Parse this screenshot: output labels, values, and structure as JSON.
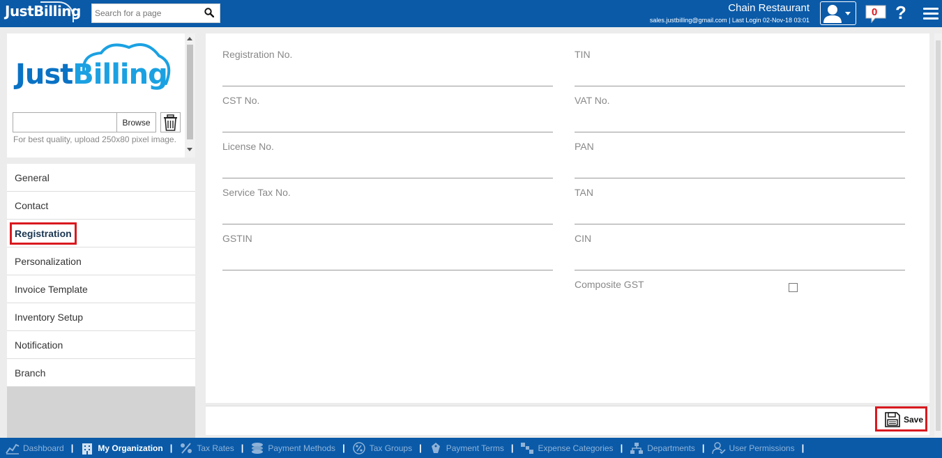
{
  "header": {
    "brand": "JustBilling",
    "search_placeholder": "Search for a page",
    "org_name": "Chain Restaurant",
    "user_line": "sales.justbilling@gmail.com | Last Login 02-Nov-18 03:01",
    "notification_count": "0",
    "help_label": "?"
  },
  "logo_panel": {
    "logo_just": "Just",
    "logo_billing": "Billing",
    "browse_label": "Browse",
    "upload_hint": "For best quality, upload 250x80 pixel image."
  },
  "nav": {
    "items": [
      {
        "label": "General"
      },
      {
        "label": "Contact"
      },
      {
        "label": "Registration",
        "active": true
      },
      {
        "label": "Personalization"
      },
      {
        "label": "Invoice Template"
      },
      {
        "label": "Inventory Setup"
      },
      {
        "label": "Notification"
      },
      {
        "label": "Branch"
      }
    ]
  },
  "form": {
    "fields": [
      {
        "label": "Registration No.",
        "value": ""
      },
      {
        "label": "TIN",
        "value": ""
      },
      {
        "label": "CST No.",
        "value": ""
      },
      {
        "label": "VAT No.",
        "value": ""
      },
      {
        "label": "License No.",
        "value": ""
      },
      {
        "label": "PAN",
        "value": ""
      },
      {
        "label": "Service Tax No.",
        "value": ""
      },
      {
        "label": "TAN",
        "value": ""
      },
      {
        "label": "GSTIN",
        "value": ""
      },
      {
        "label": "CIN",
        "value": ""
      }
    ],
    "composite_label": "Composite GST",
    "composite_checked": false,
    "save_label": "Save"
  },
  "bottom_nav": {
    "items": [
      {
        "label": "Dashboard",
        "icon": "chart-icon",
        "active": false
      },
      {
        "label": "My Organization",
        "icon": "building-icon",
        "active": true
      },
      {
        "label": "Tax Rates",
        "icon": "percent-icon",
        "active": false
      },
      {
        "label": "Payment Methods",
        "icon": "coins-icon",
        "active": false
      },
      {
        "label": "Tax Groups",
        "icon": "percent-circle-icon",
        "active": false
      },
      {
        "label": "Payment Terms",
        "icon": "tag-icon",
        "active": false
      },
      {
        "label": "Expense Categories",
        "icon": "category-icon",
        "active": false
      },
      {
        "label": "Departments",
        "icon": "org-chart-icon",
        "active": false
      },
      {
        "label": "User Permissions",
        "icon": "user-permission-icon",
        "active": false
      }
    ]
  },
  "colors": {
    "header_bg": "#0a5aa8",
    "highlight_red": "#d9191f"
  }
}
